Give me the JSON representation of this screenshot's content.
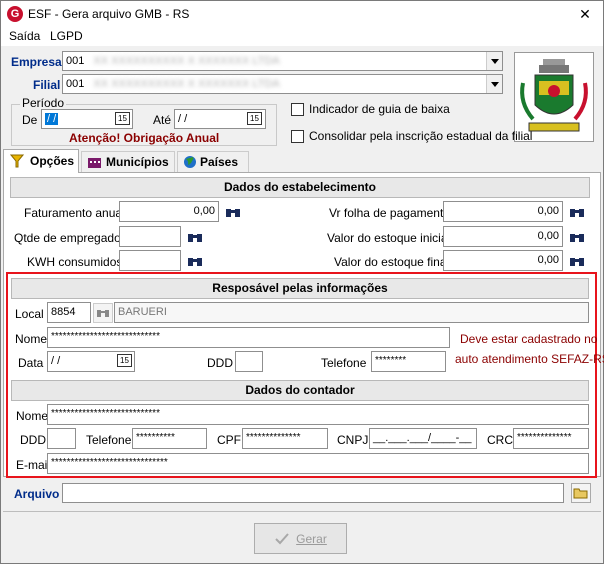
{
  "window": {
    "title": "ESF - Gera arquivo GMB - RS",
    "close_glyph": "✕"
  },
  "menu": {
    "items": [
      "Saída",
      "LGPD"
    ]
  },
  "header": {
    "empresa_label": "Empresa",
    "empresa_code": "001",
    "empresa_name": "XX XXXXXXXXXX X XXXXXXX LTDA",
    "filial_label": "Filial",
    "filial_code": "001",
    "filial_name": "XX XXXXXXXXXX X XXXXXXX LTDA",
    "periodo_label": "Período",
    "de_label": "De",
    "de_value": "/ /",
    "ate_label": "Até",
    "ate_value": "/ /",
    "cal_glyph": "15",
    "warning": "Atenção! Obrigação Anual",
    "chk_guia": "Indicador de guia de baixa",
    "chk_consolidar": "Consolidar pela inscrição estadual da filial"
  },
  "tabs": [
    "Opções",
    "Municípios",
    "Países"
  ],
  "estab": {
    "title": "Dados do estabelecimento",
    "faturamento_label": "Faturamento anual",
    "faturamento_value": "0,00",
    "folha_label": "Vr folha de pagamento",
    "folha_value": "0,00",
    "empregados_label": "Qtde de empregados",
    "empregados_value": "",
    "estoque_ini_label": "Valor do estoque inicial",
    "estoque_ini_value": "0,00",
    "kwh_label": "KWH consumidos",
    "kwh_value": "",
    "estoque_fim_label": "Valor do estoque final",
    "estoque_fim_value": "0,00"
  },
  "resp": {
    "title": "Resposável pelas informações",
    "local_label": "Local",
    "local_code": "8854",
    "local_name": "BARUERI",
    "nome_label": "Nome",
    "nome_value": "****************************",
    "note_line1": "Deve estar cadastrado no",
    "note_line2": "auto atendimento SEFAZ-RS",
    "data_label": "Data",
    "data_value": "/ /",
    "ddd_label": "DDD",
    "ddd_value": "",
    "telefone_label": "Telefone",
    "telefone_value": "********"
  },
  "contador": {
    "title": "Dados do contador",
    "nome_label": "Nome",
    "nome_value": "****************************",
    "ddd_label": "DDD",
    "ddd_value": "",
    "telefone_label": "Telefone",
    "telefone_value": "**********",
    "cpf_label": "CPF",
    "cpf_value": "**************",
    "cnpj_label": "CNPJ",
    "cnpj_value": "__.___.___/____-__",
    "crc_label": "CRC",
    "crc_value": "**************",
    "email_label": "E-mail",
    "email_value": "******************************"
  },
  "arquivo": {
    "label": "Arquivo",
    "value": ""
  },
  "footer": {
    "gerar_label": "Gerar"
  },
  "colors": {
    "accent_red": "#8b0000",
    "label_blue": "#002c8a",
    "highlight_border": "#e8141c"
  }
}
